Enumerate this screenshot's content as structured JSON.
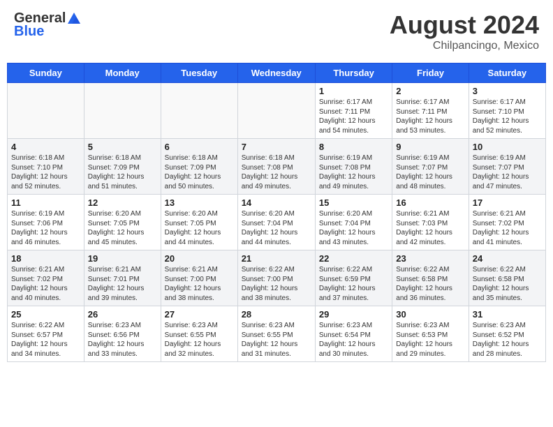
{
  "header": {
    "logo_general": "General",
    "logo_blue": "Blue",
    "month_year": "August 2024",
    "location": "Chilpancingo, Mexico"
  },
  "days_of_week": [
    "Sunday",
    "Monday",
    "Tuesday",
    "Wednesday",
    "Thursday",
    "Friday",
    "Saturday"
  ],
  "weeks": [
    [
      {
        "day": "",
        "content": ""
      },
      {
        "day": "",
        "content": ""
      },
      {
        "day": "",
        "content": ""
      },
      {
        "day": "",
        "content": ""
      },
      {
        "day": "1",
        "content": "Sunrise: 6:17 AM\nSunset: 7:11 PM\nDaylight: 12 hours\nand 54 minutes."
      },
      {
        "day": "2",
        "content": "Sunrise: 6:17 AM\nSunset: 7:11 PM\nDaylight: 12 hours\nand 53 minutes."
      },
      {
        "day": "3",
        "content": "Sunrise: 6:17 AM\nSunset: 7:10 PM\nDaylight: 12 hours\nand 52 minutes."
      }
    ],
    [
      {
        "day": "4",
        "content": "Sunrise: 6:18 AM\nSunset: 7:10 PM\nDaylight: 12 hours\nand 52 minutes."
      },
      {
        "day": "5",
        "content": "Sunrise: 6:18 AM\nSunset: 7:09 PM\nDaylight: 12 hours\nand 51 minutes."
      },
      {
        "day": "6",
        "content": "Sunrise: 6:18 AM\nSunset: 7:09 PM\nDaylight: 12 hours\nand 50 minutes."
      },
      {
        "day": "7",
        "content": "Sunrise: 6:18 AM\nSunset: 7:08 PM\nDaylight: 12 hours\nand 49 minutes."
      },
      {
        "day": "8",
        "content": "Sunrise: 6:19 AM\nSunset: 7:08 PM\nDaylight: 12 hours\nand 49 minutes."
      },
      {
        "day": "9",
        "content": "Sunrise: 6:19 AM\nSunset: 7:07 PM\nDaylight: 12 hours\nand 48 minutes."
      },
      {
        "day": "10",
        "content": "Sunrise: 6:19 AM\nSunset: 7:07 PM\nDaylight: 12 hours\nand 47 minutes."
      }
    ],
    [
      {
        "day": "11",
        "content": "Sunrise: 6:19 AM\nSunset: 7:06 PM\nDaylight: 12 hours\nand 46 minutes."
      },
      {
        "day": "12",
        "content": "Sunrise: 6:20 AM\nSunset: 7:05 PM\nDaylight: 12 hours\nand 45 minutes."
      },
      {
        "day": "13",
        "content": "Sunrise: 6:20 AM\nSunset: 7:05 PM\nDaylight: 12 hours\nand 44 minutes."
      },
      {
        "day": "14",
        "content": "Sunrise: 6:20 AM\nSunset: 7:04 PM\nDaylight: 12 hours\nand 44 minutes."
      },
      {
        "day": "15",
        "content": "Sunrise: 6:20 AM\nSunset: 7:04 PM\nDaylight: 12 hours\nand 43 minutes."
      },
      {
        "day": "16",
        "content": "Sunrise: 6:21 AM\nSunset: 7:03 PM\nDaylight: 12 hours\nand 42 minutes."
      },
      {
        "day": "17",
        "content": "Sunrise: 6:21 AM\nSunset: 7:02 PM\nDaylight: 12 hours\nand 41 minutes."
      }
    ],
    [
      {
        "day": "18",
        "content": "Sunrise: 6:21 AM\nSunset: 7:02 PM\nDaylight: 12 hours\nand 40 minutes."
      },
      {
        "day": "19",
        "content": "Sunrise: 6:21 AM\nSunset: 7:01 PM\nDaylight: 12 hours\nand 39 minutes."
      },
      {
        "day": "20",
        "content": "Sunrise: 6:21 AM\nSunset: 7:00 PM\nDaylight: 12 hours\nand 38 minutes."
      },
      {
        "day": "21",
        "content": "Sunrise: 6:22 AM\nSunset: 7:00 PM\nDaylight: 12 hours\nand 38 minutes."
      },
      {
        "day": "22",
        "content": "Sunrise: 6:22 AM\nSunset: 6:59 PM\nDaylight: 12 hours\nand 37 minutes."
      },
      {
        "day": "23",
        "content": "Sunrise: 6:22 AM\nSunset: 6:58 PM\nDaylight: 12 hours\nand 36 minutes."
      },
      {
        "day": "24",
        "content": "Sunrise: 6:22 AM\nSunset: 6:58 PM\nDaylight: 12 hours\nand 35 minutes."
      }
    ],
    [
      {
        "day": "25",
        "content": "Sunrise: 6:22 AM\nSunset: 6:57 PM\nDaylight: 12 hours\nand 34 minutes."
      },
      {
        "day": "26",
        "content": "Sunrise: 6:23 AM\nSunset: 6:56 PM\nDaylight: 12 hours\nand 33 minutes."
      },
      {
        "day": "27",
        "content": "Sunrise: 6:23 AM\nSunset: 6:55 PM\nDaylight: 12 hours\nand 32 minutes."
      },
      {
        "day": "28",
        "content": "Sunrise: 6:23 AM\nSunset: 6:55 PM\nDaylight: 12 hours\nand 31 minutes."
      },
      {
        "day": "29",
        "content": "Sunrise: 6:23 AM\nSunset: 6:54 PM\nDaylight: 12 hours\nand 30 minutes."
      },
      {
        "day": "30",
        "content": "Sunrise: 6:23 AM\nSunset: 6:53 PM\nDaylight: 12 hours\nand 29 minutes."
      },
      {
        "day": "31",
        "content": "Sunrise: 6:23 AM\nSunset: 6:52 PM\nDaylight: 12 hours\nand 28 minutes."
      }
    ]
  ]
}
